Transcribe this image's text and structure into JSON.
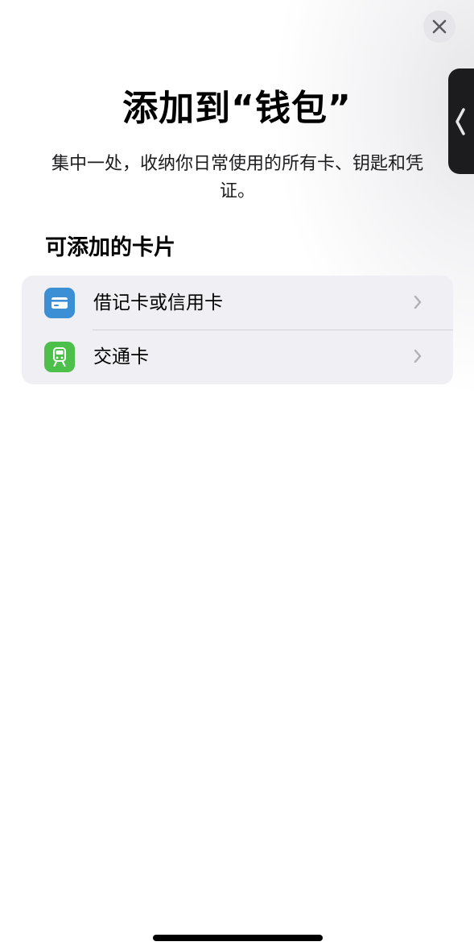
{
  "header": {
    "close_icon": "close-icon",
    "side_handle_icon": "chevron-left-icon"
  },
  "title": "添加到“钱包”",
  "subtitle": "集中一处，收纳你日常使用的所有卡、钥匙和凭证。",
  "section_title": "可添加的卡片",
  "items": [
    {
      "label": "借记卡或信用卡",
      "icon": "credit-card-icon",
      "icon_color": "#3b8fd4"
    },
    {
      "label": "交通卡",
      "icon": "train-icon",
      "icon_color": "#4cc04a"
    }
  ],
  "colors": {
    "group_background": "#efeff4",
    "chevron": "#b0b0b5"
  }
}
